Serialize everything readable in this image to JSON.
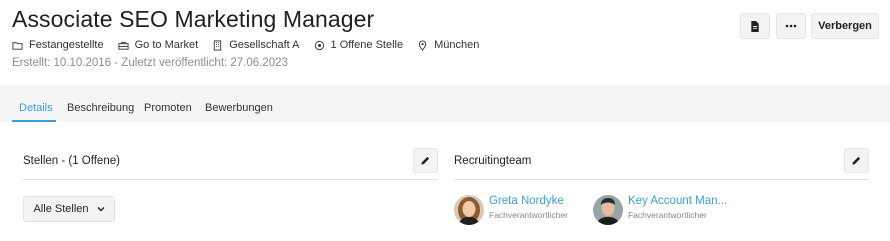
{
  "job": {
    "title": "Associate SEO Marketing Manager",
    "meta": [
      {
        "icon": "folder-icon",
        "label": "Festangestellte"
      },
      {
        "icon": "briefcase-icon",
        "label": "Go to Market"
      },
      {
        "icon": "building-icon",
        "label": "Gesellschaft A"
      },
      {
        "icon": "target-icon",
        "label": "1 Offene Stelle"
      },
      {
        "icon": "location-pin-icon",
        "label": "München"
      }
    ],
    "subtitle": "Erstellt: 10.10.2016 - Zuletzt veröffentlicht: 27.06.2023"
  },
  "actions": {
    "doc_icon": "document-icon",
    "more_icon": "more-icon",
    "hide_label": "Verbergen"
  },
  "tabs": [
    {
      "label": "Details",
      "active": true
    },
    {
      "label": "Beschreibung",
      "active": false
    },
    {
      "label": "Promoten",
      "active": false
    },
    {
      "label": "Bewerbungen",
      "active": false
    }
  ],
  "positions": {
    "title": "Stellen - (1 Offene)",
    "filter_label": "Alle Stellen"
  },
  "team": {
    "title": "Recruitingteam",
    "members": [
      {
        "name": "Greta Nordyke",
        "role": "Fachverantwortlicher"
      },
      {
        "name": "Key Account Man...",
        "role": "Fachverantwortlicher"
      }
    ]
  },
  "colors": {
    "accent": "#3a9fd6",
    "page_bg": "#f4f5f7"
  }
}
